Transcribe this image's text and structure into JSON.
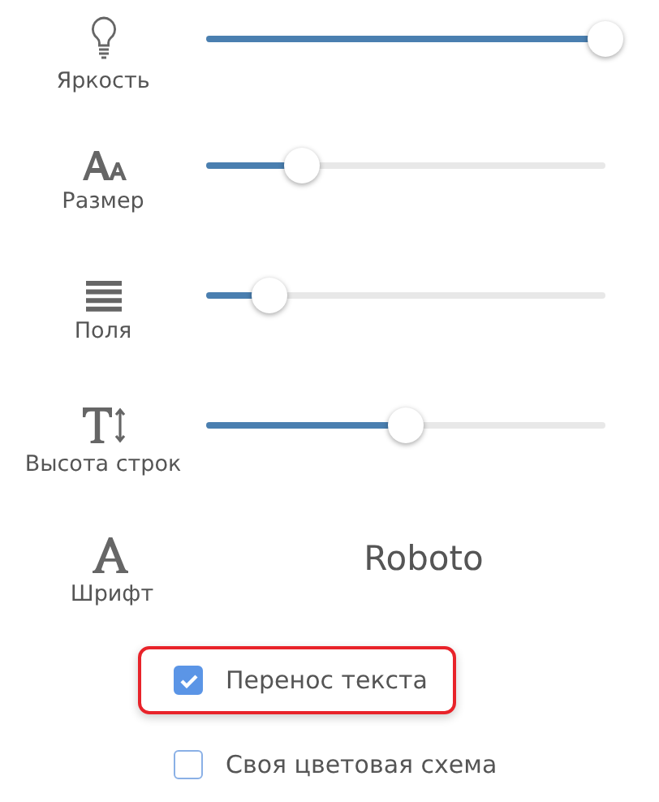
{
  "settings": [
    {
      "kind": "slider",
      "label": "Яркость",
      "level": 1.0
    },
    {
      "kind": "slider",
      "label": "Размер",
      "level": 0.24
    },
    {
      "kind": "slider",
      "label": "Поля",
      "level": 0.16
    },
    {
      "kind": "slider",
      "label": "Высота строк",
      "level": 0.5
    },
    {
      "kind": "font",
      "label": "Шрифт",
      "value": "Roboto"
    }
  ],
  "options": [
    {
      "label": "Перенос текста",
      "checked": true,
      "highlighted": true
    },
    {
      "label": "Своя цветовая схема",
      "checked": false,
      "highlighted": false
    }
  ]
}
